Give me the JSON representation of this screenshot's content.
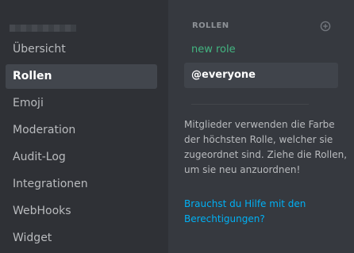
{
  "sidebar": {
    "items": [
      {
        "label": "Übersicht"
      },
      {
        "label": "Rollen",
        "active": true
      },
      {
        "label": "Emoji"
      },
      {
        "label": "Moderation"
      },
      {
        "label": "Audit-Log"
      },
      {
        "label": "Integrationen"
      },
      {
        "label": "WebHooks"
      },
      {
        "label": "Widget"
      }
    ]
  },
  "roles": {
    "header": "ROLLEN",
    "add_icon": "plus-circle-icon",
    "items": [
      {
        "label": "new role",
        "color": "#43b581"
      },
      {
        "label": "@everyone",
        "selected": true
      }
    ]
  },
  "help": {
    "text_lines": [
      "Mitglieder verwenden die Farbe",
      "der höchsten Rolle, welcher sie",
      "zugeordnet sind. Ziehe die Rollen,",
      "um sie neu anzuordnen!"
    ],
    "link_lines": [
      "Brauchst du Hilfe mit den",
      "Berechtigungen?"
    ]
  },
  "colors": {
    "sidebar_bg": "#2f3136",
    "content_bg": "#36393f",
    "active_item_bg": "#42464d",
    "link": "#00b0f4",
    "role_green": "#43b581"
  }
}
